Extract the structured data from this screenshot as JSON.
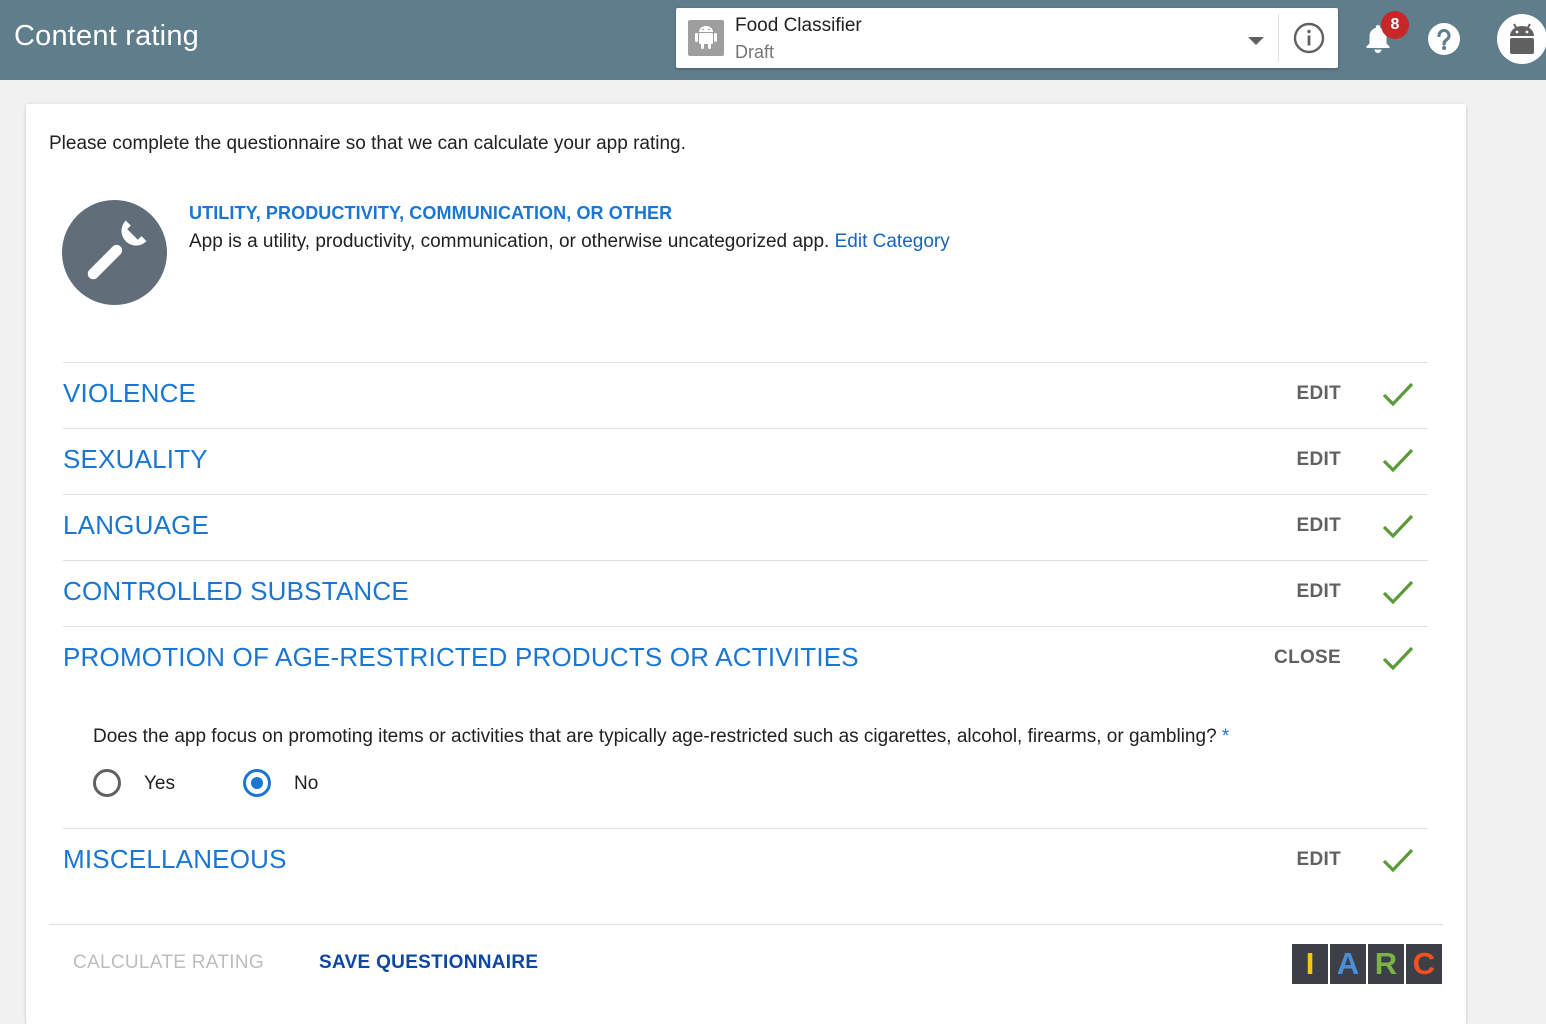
{
  "header": {
    "title": "Content rating",
    "app": {
      "name": "Food Classifier",
      "status": "Draft"
    },
    "notifications_count": "8",
    "icons": {
      "app": "android-app-icon",
      "dropdown": "chevron-down-icon",
      "info": "info-icon",
      "notifications": "bell-icon",
      "help": "help-icon",
      "avatar": "android-avatar-icon"
    }
  },
  "main": {
    "intro": "Please complete the questionnaire so that we can calculate your app rating.",
    "category": {
      "icon": "wrench-icon",
      "title": "UTILITY, PRODUCTIVITY, COMMUNICATION, OR OTHER",
      "description": "App is a utility, productivity, communication, or otherwise uncategorized app.",
      "edit_label": "Edit Category"
    },
    "sections": [
      {
        "title": "VIOLENCE",
        "action": "EDIT",
        "completed": true
      },
      {
        "title": "SEXUALITY",
        "action": "EDIT",
        "completed": true
      },
      {
        "title": "LANGUAGE",
        "action": "EDIT",
        "completed": true
      },
      {
        "title": "CONTROLLED SUBSTANCE",
        "action": "EDIT",
        "completed": true
      },
      {
        "title": "PROMOTION OF AGE-RESTRICTED PRODUCTS OR ACTIVITIES",
        "action": "CLOSE",
        "completed": true
      },
      {
        "title": "MISCELLANEOUS",
        "action": "EDIT",
        "completed": true
      }
    ],
    "question": {
      "text": "Does the app focus on promoting items or activities that are typically age-restricted such as cigarettes, alcohol, firearms, or gambling?",
      "required_mark": "*",
      "options": [
        {
          "label": "Yes",
          "selected": false
        },
        {
          "label": "No",
          "selected": true
        }
      ]
    }
  },
  "footer": {
    "calculate_label": "CALCULATE RATING",
    "save_label": "SAVE QUESTIONNAIRE",
    "logo_letters": [
      "I",
      "A",
      "R",
      "C"
    ]
  },
  "colors": {
    "topbar": "#607d8b",
    "accent": "#1976d2",
    "check": "#5a9a3a",
    "badge": "#c62828",
    "iarc": [
      "#f5c518",
      "#4a90d9",
      "#7cb342",
      "#f4511e"
    ]
  }
}
